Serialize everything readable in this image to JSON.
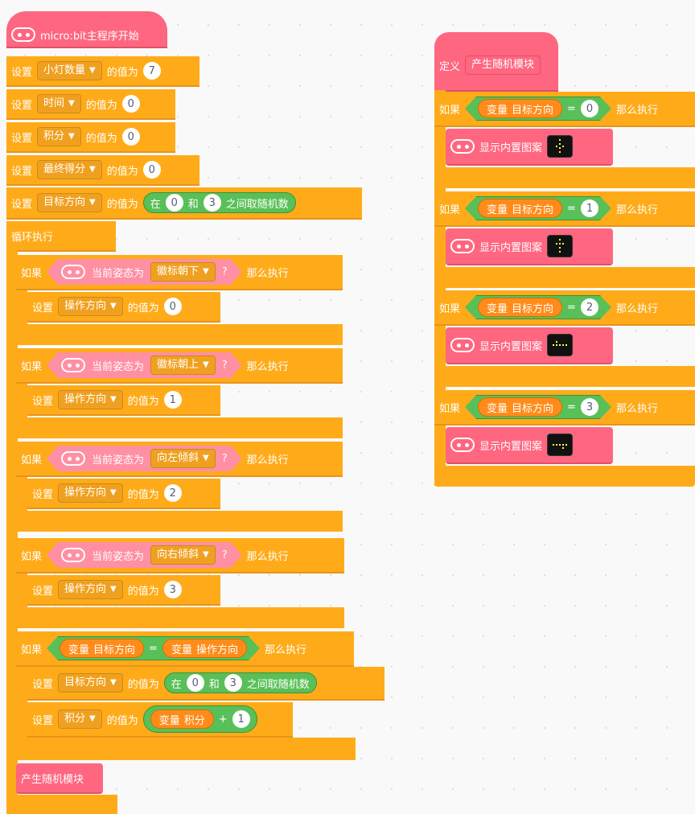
{
  "main": {
    "hat_label": "micro:bit主程序开始",
    "set_label": "设置",
    "value_label": "的值为",
    "sets": [
      {
        "var": "小灯数量",
        "value": "7"
      },
      {
        "var": "时间",
        "value": "0"
      },
      {
        "var": "积分",
        "value": "0"
      },
      {
        "var": "最终得分",
        "value": "0"
      }
    ],
    "set_target": {
      "var": "目标方向",
      "rand_in": "在",
      "rand_min": "0",
      "rand_and": "和",
      "rand_max": "3",
      "rand_suffix": "之间取随机数"
    },
    "loop_label": "循环执行",
    "if_label": "如果",
    "then_label": "那么执行",
    "posture_label": "当前姿态为",
    "question": "?",
    "gesture_ifs": [
      {
        "gesture": "徽标朝下",
        "set_var": "操作方向",
        "value": "0"
      },
      {
        "gesture": "徽标朝上",
        "set_var": "操作方向",
        "value": "1"
      },
      {
        "gesture": "向左倾斜",
        "set_var": "操作方向",
        "value": "2"
      },
      {
        "gesture": "向右倾斜",
        "set_var": "操作方向",
        "value": "3"
      }
    ],
    "compare_if": {
      "left_var_prefix": "变量",
      "left_var": "目标方向",
      "op": "=",
      "right_var_prefix": "变量",
      "right_var": "操作方向",
      "set1_var": "目标方向",
      "rand_in": "在",
      "rand_min": "0",
      "rand_and": "和",
      "rand_max": "3",
      "rand_suffix": "之间取随机数",
      "set2_var": "积分",
      "add_var_prefix": "变量",
      "add_var": "积分",
      "plus": "+",
      "add_value": "1"
    },
    "call_label": "产生随机模块"
  },
  "define": {
    "define_label": "定义",
    "name": "产生随机模块",
    "if_label": "如果",
    "then_label": "那么执行",
    "var_prefix": "变量",
    "var_name": "目标方向",
    "op": "=",
    "show_label": "显示内置图案",
    "cases": [
      {
        "value": "0"
      },
      {
        "value": "1"
      },
      {
        "value": "2"
      },
      {
        "value": "3"
      }
    ]
  },
  "colors": {
    "control": "#ffab19",
    "microbit": "#ff6680",
    "operator": "#59c059",
    "variable": "#ff8c1a",
    "background": "#f9f9f9"
  },
  "icons": [
    "microbit-icon",
    "dropdown-caret-icon",
    "led-pattern-icon"
  ]
}
